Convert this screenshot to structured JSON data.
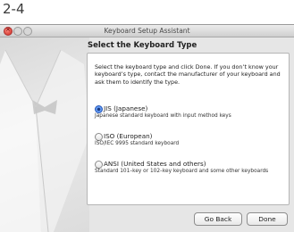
{
  "page_label": "2-4",
  "window": {
    "title": "Keyboard Setup Assistant",
    "heading": "Select the Keyboard Type",
    "instructions": "Select the keyboard type and click Done. If you don’t know your keyboard’s type, contact the manufacturer of your keyboard and ask them to identify the type."
  },
  "options": [
    {
      "title": "JIS (Japanese)",
      "desc": "Japanese standard keyboard with input method keys",
      "selected": true
    },
    {
      "title": "ISO (European)",
      "desc": "ISO/IEC 9995 standard keyboard",
      "selected": false
    },
    {
      "title": "ANSI (United States and others)",
      "desc": "Standard 101–key or 102–key keyboard and some other keyboards",
      "selected": false
    }
  ],
  "buttons": {
    "back": "Go Back",
    "done": "Done"
  }
}
